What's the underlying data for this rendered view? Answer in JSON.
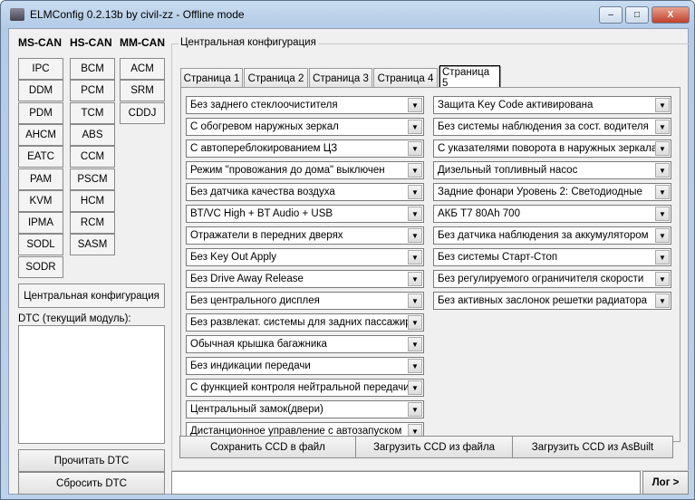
{
  "window": {
    "title": "ELMConfig 0.2.13b by civil-zz - Offline mode",
    "min": "–",
    "max": "□",
    "close": "X"
  },
  "modules": {
    "headers": [
      "MS-CAN",
      "HS-CAN",
      "MM-CAN"
    ],
    "ms_can": [
      "IPC",
      "DDM",
      "PDM",
      "AHCM",
      "EATC",
      "PAM",
      "KVM",
      "IPMA",
      "SODL",
      "SODR"
    ],
    "hs_can": [
      "BCM",
      "PCM",
      "TCM",
      "ABS",
      "CCM",
      "PSCM",
      "HCM",
      "RCM",
      "SASM"
    ],
    "mm_can": [
      "ACM",
      "SRM",
      "CDDJ"
    ]
  },
  "central_config_button": "Центральная конфигурация",
  "dtc": {
    "label": "DTC (текущий модуль):",
    "read": "Прочитать DTC",
    "reset": "Сбросить DTC"
  },
  "group": {
    "title": "Центральная конфигурация",
    "tabs": [
      "Страница 1",
      "Страница 2",
      "Страница 3",
      "Страница 4",
      "Страница 5"
    ],
    "active_tab": 4,
    "left": [
      "Без заднего стеклоочистителя",
      "С обогревом наружных зеркал",
      "С автопереблокированием ЦЗ",
      "Режим \"провожания до дома\" выключен",
      "Без датчика качества воздуха",
      "BT/VC High + BT Audio + USB",
      "Отражатели в передних дверях",
      "Без Key Out Apply",
      "Без Drive Away Release",
      "Без центрального дисплея",
      "Без развлекат. системы для задних пассажиров",
      "Обычная крышка багажника",
      "Без индикации передачи",
      "С функцией контроля нейтральной передачи",
      "Центральный замок(двери)",
      "Дистанционное управление с автозапуском"
    ],
    "right": [
      "Защита Key Code активирована",
      "Без системы наблюдения за сост. водителя",
      "С указателями поворота в наружных зеркалах",
      "Дизельный топливный насос",
      "Задние фонари Уровень 2: Светодиодные",
      "АКБ T7 80Ah 700",
      "Без датчика наблюдения за аккумулятором",
      "Без системы Старт-Стоп",
      "Без регулируемого ограничителя скорости",
      "Без активных заслонок решетки радиатора"
    ],
    "buttons": [
      "Сохранить CCD в файл",
      "Загрузить CCD из файла",
      "Загрузить CCD из AsBuilt"
    ]
  },
  "log": {
    "value": "",
    "button": "Лог >"
  }
}
